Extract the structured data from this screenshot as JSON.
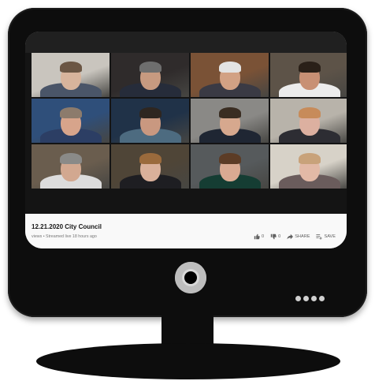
{
  "video": {
    "title": "12.21.2020 City Council",
    "meta": "views • Streamed live 18 hours ago",
    "likes": "0",
    "dislikes": "0",
    "share_label": "SHARE",
    "save_label": "SAVE"
  },
  "participants": [
    {
      "bg": "#c9c5be",
      "skin": "#d8b49c",
      "hair": "#6b5644",
      "shirt": "#4a5568"
    },
    {
      "bg": "#2f2b2b",
      "skin": "#c79a80",
      "hair": "#6e6e6e",
      "shirt": "#262c3a"
    },
    {
      "bg": "#7a5236",
      "skin": "#d2a184",
      "hair": "#e3e3e3",
      "shirt": "#3a3a44"
    },
    {
      "bg": "#5d5348",
      "skin": "#c89074",
      "hair": "#2a2018",
      "shirt": "#ececec"
    },
    {
      "bg": "#2f4f7a",
      "skin": "#d7a48b",
      "hair": "#8c7b6c",
      "shirt": "#2c3e64"
    },
    {
      "bg": "#203248",
      "skin": "#c99880",
      "hair": "#2e2620",
      "shirt": "#4d6b80"
    },
    {
      "bg": "#8a8986",
      "skin": "#d6a88e",
      "hair": "#3a2d22",
      "shirt": "#1f2633"
    },
    {
      "bg": "#b8b3aa",
      "skin": "#dcb0a0",
      "hair": "#c78b5a",
      "shirt": "#2d2d33"
    },
    {
      "bg": "#6a5d4e",
      "skin": "#d2a890",
      "hair": "#8a8a88",
      "shirt": "#dcdcdc"
    },
    {
      "bg": "#4f4537",
      "skin": "#d9b09a",
      "hair": "#9a6a3c",
      "shirt": "#1e1e22"
    },
    {
      "bg": "#565a5c",
      "skin": "#d9aa92",
      "hair": "#5c3c26",
      "shirt": "#153d33"
    },
    {
      "bg": "#d7d2c8",
      "skin": "#e2b9a6",
      "hair": "#c8a27a",
      "shirt": "#6a5c5c"
    }
  ]
}
